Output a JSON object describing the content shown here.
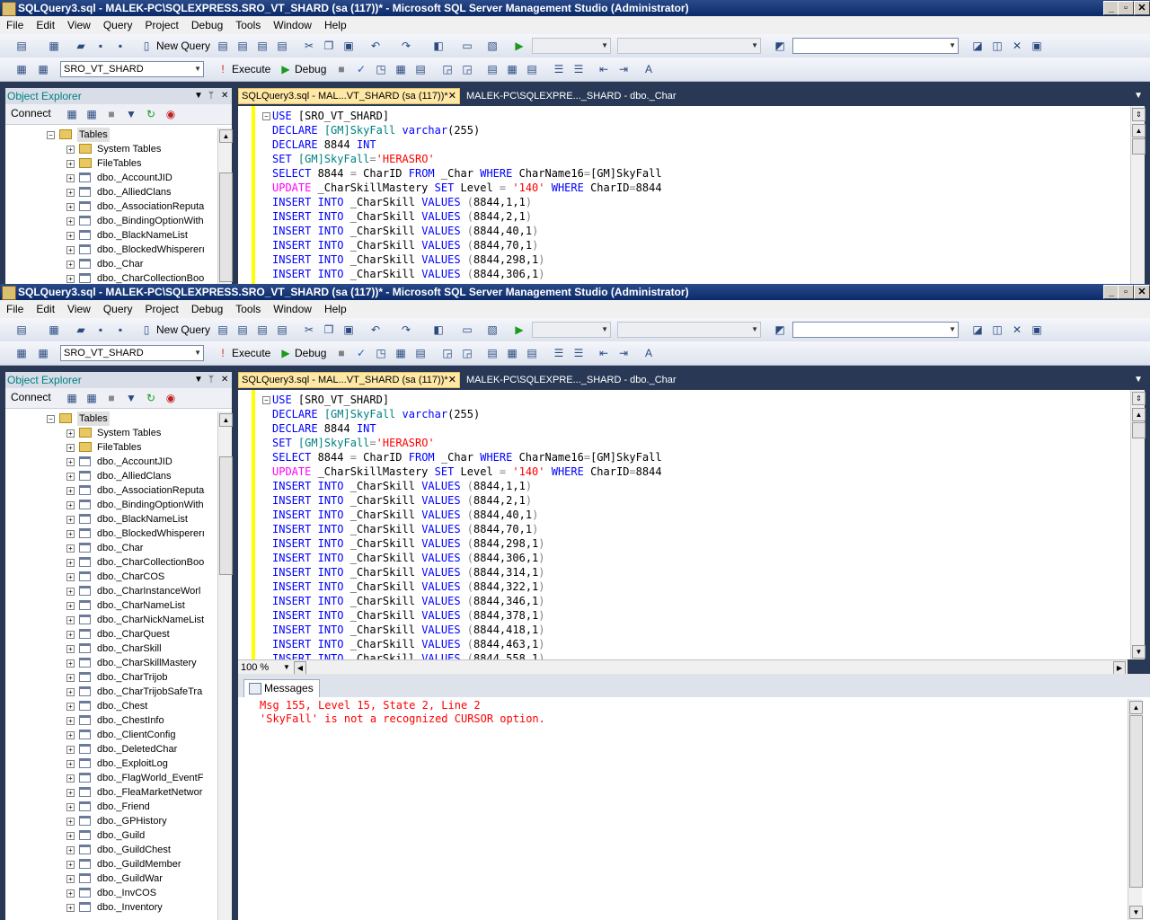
{
  "window": {
    "title": "SQLQuery3.sql - MALEK-PC\\SQLEXPRESS.SRO_VT_SHARD (sa (117))* - Microsoft SQL Server Management Studio (Administrator)"
  },
  "menu": [
    "File",
    "Edit",
    "View",
    "Query",
    "Project",
    "Debug",
    "Tools",
    "Window",
    "Help"
  ],
  "toolbar": {
    "new_query": "New Query",
    "database": "SRO_VT_SHARD",
    "execute": "Execute",
    "debug": "Debug"
  },
  "object_explorer": {
    "title": "Object Explorer",
    "connect": "Connect",
    "folder": "Tables",
    "subfolders": [
      "System Tables",
      "FileTables"
    ],
    "tables": [
      "dbo._AccountJID",
      "dbo._AlliedClans",
      "dbo._AssociationReputa",
      "dbo._BindingOptionWith",
      "dbo._BlackNameList",
      "dbo._BlockedWhispererı",
      "dbo._Char",
      "dbo._CharCollectionBoo",
      "dbo._CharCOS",
      "dbo._CharInstanceWorl",
      "dbo._CharNameList",
      "dbo._CharNickNameList",
      "dbo._CharQuest",
      "dbo._CharSkill",
      "dbo._CharSkillMastery",
      "dbo._CharTrijob",
      "dbo._CharTrijobSafeTra",
      "dbo._Chest",
      "dbo._ChestInfo",
      "dbo._ClientConfig",
      "dbo._DeletedChar",
      "dbo._ExploitLog",
      "dbo._FlagWorld_EventF",
      "dbo._FleaMarketNetwor",
      "dbo._Friend",
      "dbo._GPHistory",
      "dbo._Guild",
      "dbo._GuildChest",
      "dbo._GuildMember",
      "dbo._GuildWar",
      "dbo._InvCOS",
      "dbo._Inventory"
    ]
  },
  "tabs": {
    "active": "SQLQuery3.sql - MAL...VT_SHARD (sa (117))*",
    "inactive": "MALEK-PC\\SQLEXPRE..._SHARD - dbo._Char"
  },
  "editor": {
    "use_line": "USE [SRO_VT_SHARD]",
    "declare1": "DECLARE [GM]SkyFall varchar(255)",
    "declare2": "DECLARE 8844 INT",
    "set_line": "SET [GM]SkyFall='HERASRO'",
    "select_line": "SELECT 8844 = CharID FROM _Char WHERE CharName16=[GM]SkyFall",
    "update_line": "UPDATE _CharSkillMastery SET Level = '140' WHERE CharID=8844",
    "inserts": [
      "(8844,1,1)",
      "(8844,2,1)",
      "(8844,40,1)",
      "(8844,70,1)",
      "(8844,298,1)",
      "(8844,306,1)",
      "(8844,314,1)",
      "(8844,322,1)",
      "(8844,346,1)",
      "(8844,378,1)",
      "(8844,418,1)",
      "(8844,463,1)",
      "(8844,558,1)"
    ],
    "zoom": "100 %"
  },
  "messages": {
    "tab": "Messages",
    "line1": "Msg 155, Level 15, State 2, Line 2",
    "line2": "'SkyFall' is not a recognized CURSOR option."
  }
}
